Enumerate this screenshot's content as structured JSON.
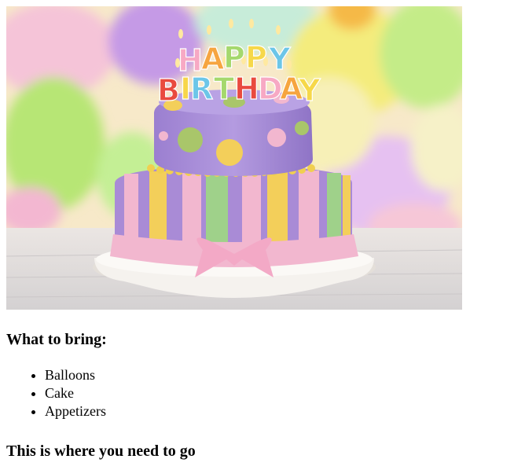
{
  "page": {
    "hero_image": {
      "icon": "birthday-cake-photo",
      "candle_text": "HAPPY BIRTHDAY"
    },
    "bring_heading": "What to bring:",
    "bring_items": [
      "Balloons",
      "Cake",
      "Appetizers"
    ],
    "go_heading": "This is where you need to go"
  },
  "colors": {
    "cake_purple": "#a98bd6",
    "ribbon_pink": "#f2b7cf",
    "stripe_yellow": "#f3cf5a",
    "stripe_green": "#9fd18a",
    "board_white": "#f4f1ec"
  }
}
